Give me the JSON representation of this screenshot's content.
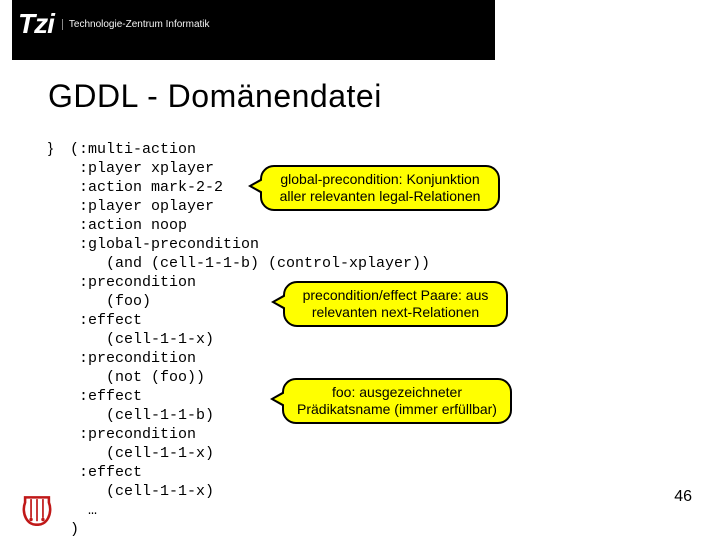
{
  "header": {
    "logo_mark": "Tzi",
    "logo_sub": "Technologie-Zentrum Informatik"
  },
  "title": "GDDL - Domänendatei",
  "bullet": "}",
  "code": "(:multi-action\n :player xplayer\n :action mark-2-2\n :player oplayer\n :action noop\n :global-precondition\n    (and (cell-1-1-b) (control-xplayer))\n :precondition\n    (foo)\n :effect\n    (cell-1-1-x)\n :precondition\n    (not (foo))\n :effect\n    (cell-1-1-b)\n :precondition\n    (cell-1-1-x)\n :effect\n    (cell-1-1-x)\n  …\n)",
  "callouts": {
    "c1_l1": "global-precondition: Konjunktion",
    "c1_l2": "aller relevanten legal-Relationen",
    "c2_l1": "precondition/effect Paare: aus",
    "c2_l2": "relevanten next-Relationen",
    "c3_l1": "foo: ausgezeichneter",
    "c3_l2": "Prädikatsname (immer erfüllbar)"
  },
  "page_number": "46"
}
